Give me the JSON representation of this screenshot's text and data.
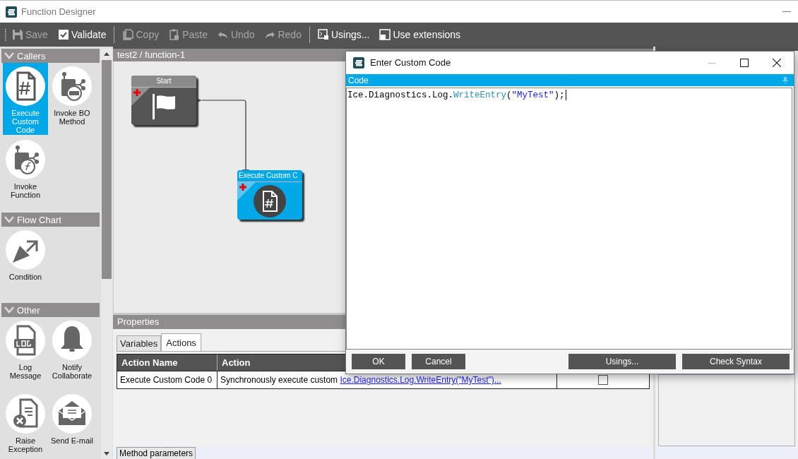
{
  "window": {
    "title": "Function Designer"
  },
  "toolbar": [
    {
      "items": [
        {
          "label": "Save",
          "disabled": true
        },
        {
          "label": "Validate",
          "disabled": false
        }
      ]
    },
    {
      "items": [
        {
          "label": "Copy",
          "disabled": true
        },
        {
          "label": "Paste",
          "disabled": true
        },
        {
          "label": "Undo",
          "disabled": true
        },
        {
          "label": "Redo",
          "disabled": true
        }
      ]
    },
    {
      "items": [
        {
          "label": "Usings...",
          "disabled": false
        },
        {
          "label": "Use extensions",
          "disabled": false
        }
      ]
    }
  ],
  "palette": [
    {
      "title": "Callers",
      "expanded": true,
      "items": [
        {
          "label": "Execute Custom Code",
          "selected": true
        },
        {
          "label": "Invoke BO Method",
          "selected": false
        },
        {
          "label": "Invoke Function",
          "selected": false
        }
      ]
    },
    {
      "title": "Flow Chart",
      "expanded": true,
      "items": [
        {
          "label": "Condition",
          "selected": false
        }
      ]
    },
    {
      "title": "Other",
      "expanded": true,
      "items": [
        {
          "label": "Log Message",
          "selected": false
        },
        {
          "label": "Notify Collaborate",
          "selected": false
        },
        {
          "label": "Raise Exception",
          "selected": false
        },
        {
          "label": "Send E-mail",
          "selected": false
        }
      ]
    }
  ],
  "canvas": {
    "breadcrumb": "test2 / function-1",
    "nodes": [
      {
        "title": "Start",
        "selected": false
      },
      {
        "title": "Execute Custom C",
        "selected": true
      }
    ]
  },
  "properties": {
    "title": "Properties",
    "tabs": [
      {
        "label": "Variables",
        "selected": false
      },
      {
        "label": "Actions",
        "selected": true
      }
    ],
    "columns": [
      "Action Name",
      "Action"
    ],
    "rows": [
      {
        "action_name": "Execute Custom Code 0",
        "action_text": "Synchronously execute custom",
        "action_link": "Ice.Diagnostics.Log.WriteEntry(\"MyTest\")...",
        "checked": false
      }
    ],
    "bottom_tab": "Method parameters"
  },
  "dialog": {
    "title": "Enter Custom Code",
    "pane_title": "Code",
    "code": [
      {
        "kind": "plain",
        "text": "Ice.Diagnostics.Log."
      },
      {
        "kind": "method",
        "text": "WriteEntry"
      },
      {
        "kind": "plain",
        "text": "("
      },
      {
        "kind": "string",
        "text": "\"MyTest\""
      },
      {
        "kind": "plain",
        "text": ");"
      }
    ],
    "buttons": [
      "OK",
      "Cancel",
      "Usings...",
      "Check Syntax"
    ]
  }
}
